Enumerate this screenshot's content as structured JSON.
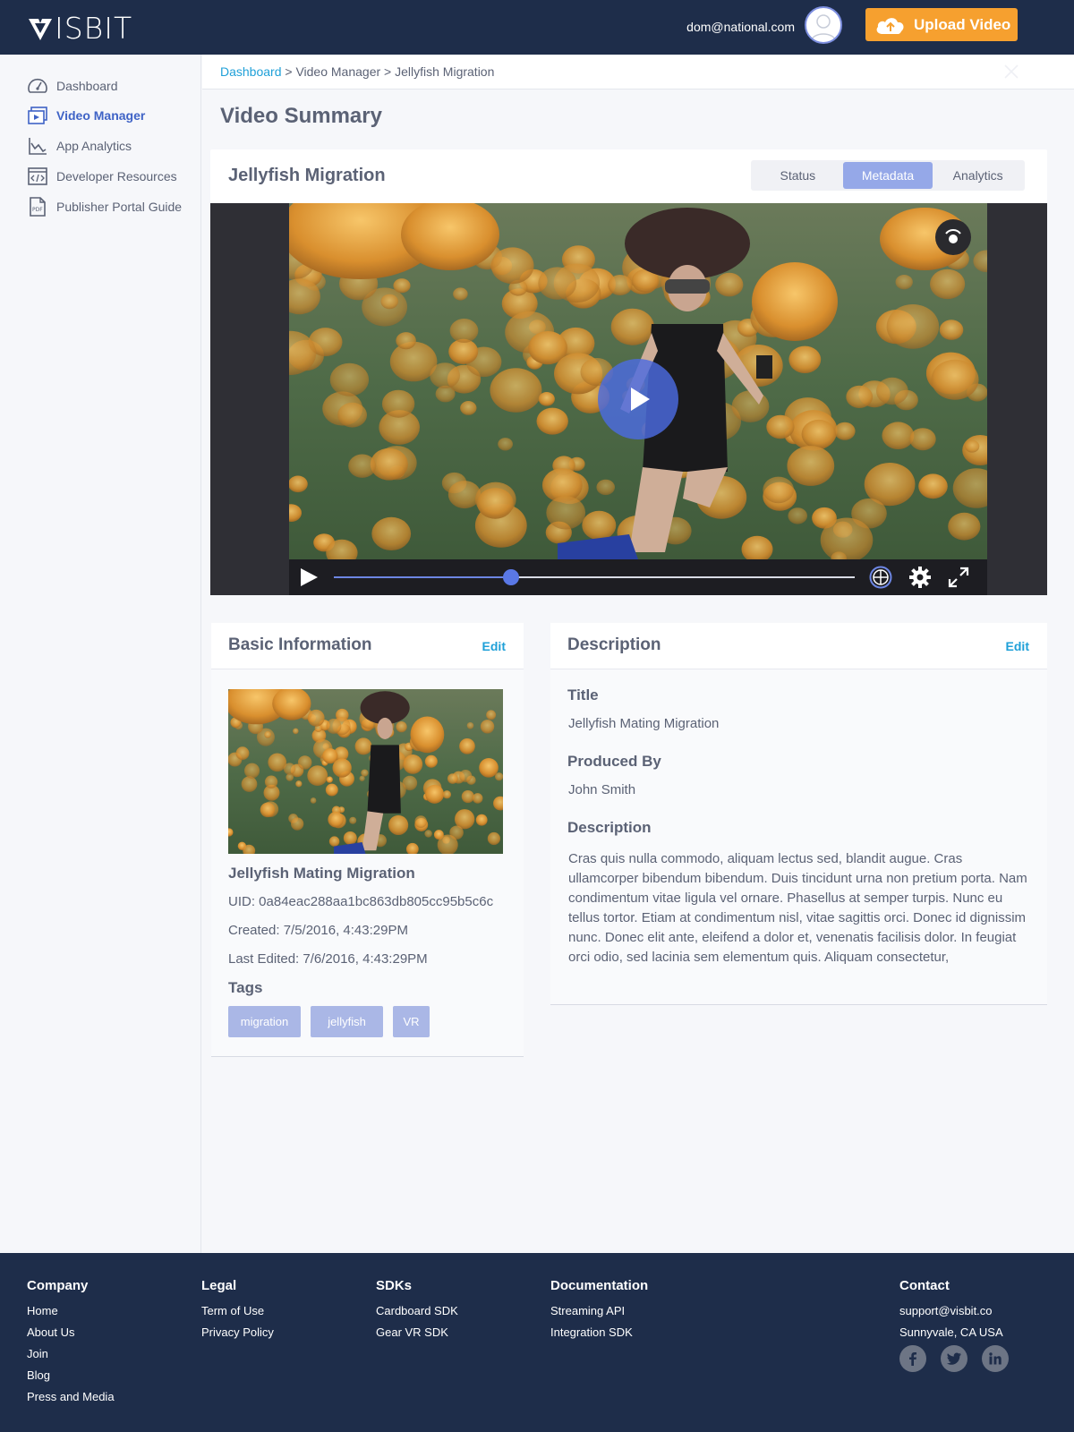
{
  "header": {
    "brand": "ISBIT",
    "user_email": "dom@national.com",
    "upload_label": "Upload Video"
  },
  "sidebar": {
    "items": [
      {
        "label": "Dashboard",
        "icon": "speedometer-icon"
      },
      {
        "label": "Video Manager",
        "icon": "video-manager-icon",
        "active": true
      },
      {
        "label": "App Analytics",
        "icon": "line-chart-icon"
      },
      {
        "label": "Developer Resources",
        "icon": "code-window-icon"
      },
      {
        "label": "Publisher Portal Guide",
        "icon": "pdf-icon"
      }
    ]
  },
  "breadcrumb": {
    "root": "Dashboard",
    "rest": " > Video Manager > Jellyfish Migration"
  },
  "page": {
    "title": "Video Summary"
  },
  "video": {
    "title": "Jellyfish Migration",
    "tabs": [
      "Status",
      "Metadata",
      "Analytics"
    ],
    "active_tab": "Metadata",
    "progress": 0.34
  },
  "basic_info": {
    "heading": "Basic Information",
    "edit_label": "Edit",
    "video_title": "Jellyfish Mating Migration",
    "uid": "UID: 0a84eac288aa1bc863db805cc95b5c6c",
    "created": "Created: 7/5/2016, 4:43:29PM",
    "last_edited": "Last Edited: 7/6/2016, 4:43:29PM",
    "tags_heading": "Tags",
    "tags": [
      "migration",
      "jellyfish",
      "VR"
    ]
  },
  "description_card": {
    "heading": "Description",
    "edit_label": "Edit",
    "title_label": "Title",
    "title_value": "Jellyfish Mating Migration",
    "produced_label": "Produced By",
    "produced_value": "John Smith",
    "description_label": "Description",
    "description_value": "Cras quis nulla commodo, aliquam lectus sed, blandit augue. Cras ullamcorper bibendum bibendum. Duis tincidunt urna non pretium porta. Nam condimentum vitae ligula vel ornare. Phasellus at semper turpis. Nunc eu tellus tortor. Etiam at condimentum nisl, vitae sagittis orci. Donec id dignissim nunc. Donec elit ante, eleifend a dolor et, venenatis facilisis dolor. In feugiat orci odio, sed lacinia sem elementum quis. Aliquam consectetur,"
  },
  "footer": {
    "company": {
      "heading": "Company",
      "links": [
        "Home",
        "About Us",
        "Join",
        "Blog",
        "Press and Media"
      ]
    },
    "legal": {
      "heading": "Legal",
      "links": [
        "Term of Use",
        "Privacy Policy"
      ]
    },
    "sdks": {
      "heading": "SDKs",
      "links": [
        "Cardboard SDK",
        "Gear VR SDK"
      ]
    },
    "documentation": {
      "heading": "Documentation",
      "links": [
        "Streaming API",
        "Integration SDK"
      ]
    },
    "contact": {
      "heading": "Contact",
      "links": [
        "support@visbit.co",
        "Sunnyvale, CA USA"
      ]
    },
    "social": [
      "facebook-icon",
      "twitter-icon",
      "linkedin-icon"
    ]
  },
  "colors": {
    "navy": "#1e2d4a",
    "accent_orange": "#f6a02f",
    "accent_blue": "#3f63c6",
    "link_blue": "#1fa0d8",
    "tab_active": "#95a8e8",
    "tag_bg": "#aab7e6"
  }
}
